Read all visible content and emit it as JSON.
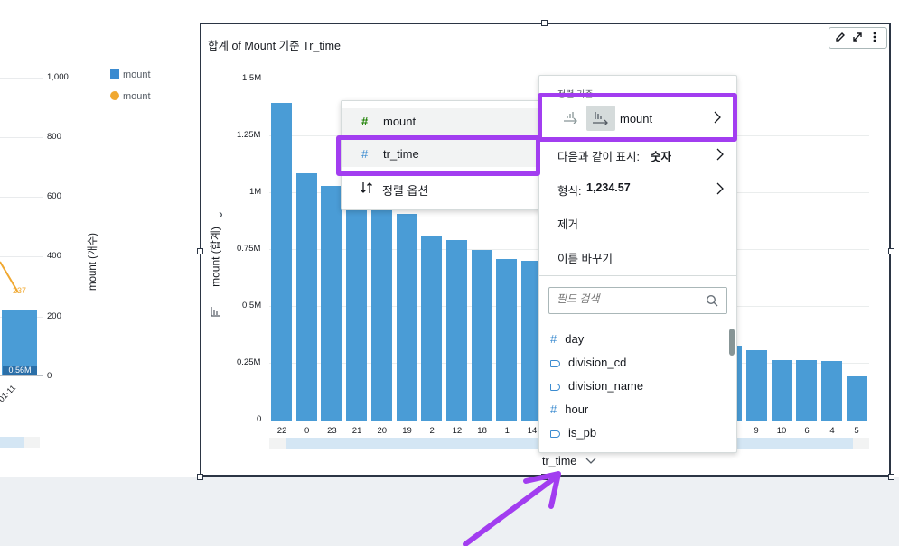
{
  "left_chart": {
    "legend": [
      {
        "label": "mount",
        "color": "#3b8bd0",
        "shape": "square"
      },
      {
        "label": "mount",
        "color": "#f0a830",
        "shape": "circle"
      }
    ],
    "yaxis_right_title": "mount (개수)",
    "right_ticks": [
      "1,000",
      "800",
      "600",
      "400",
      "200",
      "0"
    ],
    "data_label_line": "237",
    "data_label_bar": "0.56M",
    "x_label_partial": "-01-11"
  },
  "visual": {
    "title": "합계 of Mount 기준 Tr_time",
    "y_axis_title": "mount (합계)",
    "x_axis_title": "tr_time",
    "toolbar": [
      "edit-icon",
      "expand-icon",
      "more-icon"
    ]
  },
  "chart_data": {
    "type": "bar",
    "title": "합계 of Mount 기준 Tr_time",
    "xlabel": "tr_time",
    "ylabel": "mount (합계)",
    "ylim": [
      0,
      1500000
    ],
    "y_ticks": [
      "1.5M",
      "1.25M",
      "1M",
      "0.75M",
      "0.5M",
      "0.25M",
      "0"
    ],
    "categories_visible": [
      "22",
      "0",
      "23",
      "21",
      "20",
      "19",
      "2",
      "12",
      "18",
      "1",
      "14",
      "9",
      "10",
      "6",
      "4",
      "5"
    ],
    "values_visible": [
      1395000,
      1085000,
      1030000,
      1025000,
      990000,
      905000,
      810000,
      790000,
      750000,
      710000,
      700000,
      330000,
      310000,
      265000,
      265000,
      260000,
      195000
    ]
  },
  "sort_menu": {
    "items": [
      {
        "label": "mount",
        "icon": "#"
      },
      {
        "label": "tr_time",
        "icon": "#"
      },
      {
        "label": "정렬 옵션",
        "icon": "sort-icon"
      }
    ]
  },
  "field_menu": {
    "header": "정렬 기준",
    "sort_field": "mount",
    "display_label": "다음과 같이 표시:",
    "display_value": "숫자",
    "format_label": "형식:",
    "format_value": "1,234.57",
    "remove": "제거",
    "rename": "이름 바꾸기",
    "search_placeholder": "필드 검색",
    "fields": [
      {
        "name": "day",
        "type": "number"
      },
      {
        "name": "division_cd",
        "type": "string"
      },
      {
        "name": "division_name",
        "type": "string"
      },
      {
        "name": "hour",
        "type": "number"
      },
      {
        "name": "is_pb",
        "type": "string"
      }
    ]
  },
  "annotation": {
    "color": "#a23df0"
  }
}
